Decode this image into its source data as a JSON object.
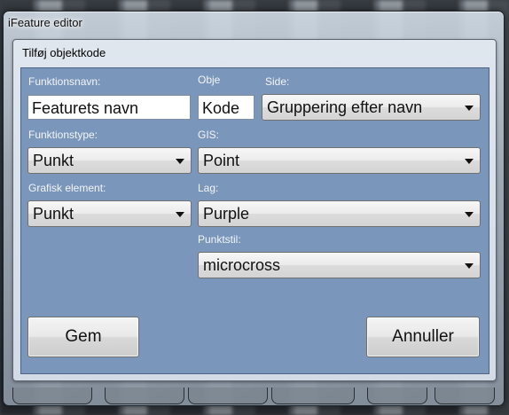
{
  "window": {
    "title": "iFeature editor"
  },
  "dialog": {
    "title": "Tilføj objektkode",
    "fields": {
      "name_label": "Funktionsnavn:",
      "name_value": "Featurets navn",
      "code_label": "Obje",
      "code_value": "Kode",
      "side_label": "Side:",
      "side_value": "Gruppering efter navn",
      "type_label": "Funktionstype:",
      "type_value": "Punkt",
      "gis_label": "GIS:",
      "gis_value": "Point",
      "graphic_label": "Grafisk element:",
      "graphic_value": "Punkt",
      "layer_label": "Lag:",
      "layer_value": "Purple",
      "pointstyle_label": "Punktstil:",
      "pointstyle_value": "microcross"
    },
    "buttons": {
      "save": "Gem",
      "cancel": "Annuller"
    }
  }
}
